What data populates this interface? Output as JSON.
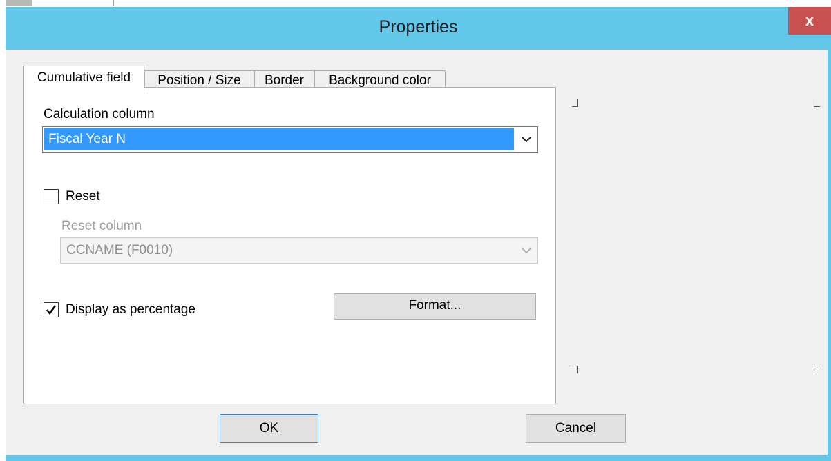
{
  "window": {
    "title": "Properties",
    "close_label": "x"
  },
  "tabs": [
    {
      "label": "Cumulative field",
      "active": true
    },
    {
      "label": "Position / Size",
      "active": false
    },
    {
      "label": "Border",
      "active": false
    },
    {
      "label": "Background color",
      "active": false
    }
  ],
  "calculation": {
    "label": "Calculation column",
    "selected": "Fiscal Year N"
  },
  "reset": {
    "label": "Reset",
    "checked": false,
    "column_label": "Reset column",
    "column_value": "CCNAME (F0010)"
  },
  "percentage": {
    "label": "Display as percentage",
    "checked": true
  },
  "format_button": "Format...",
  "footer": {
    "ok": "OK",
    "cancel": "Cancel"
  }
}
